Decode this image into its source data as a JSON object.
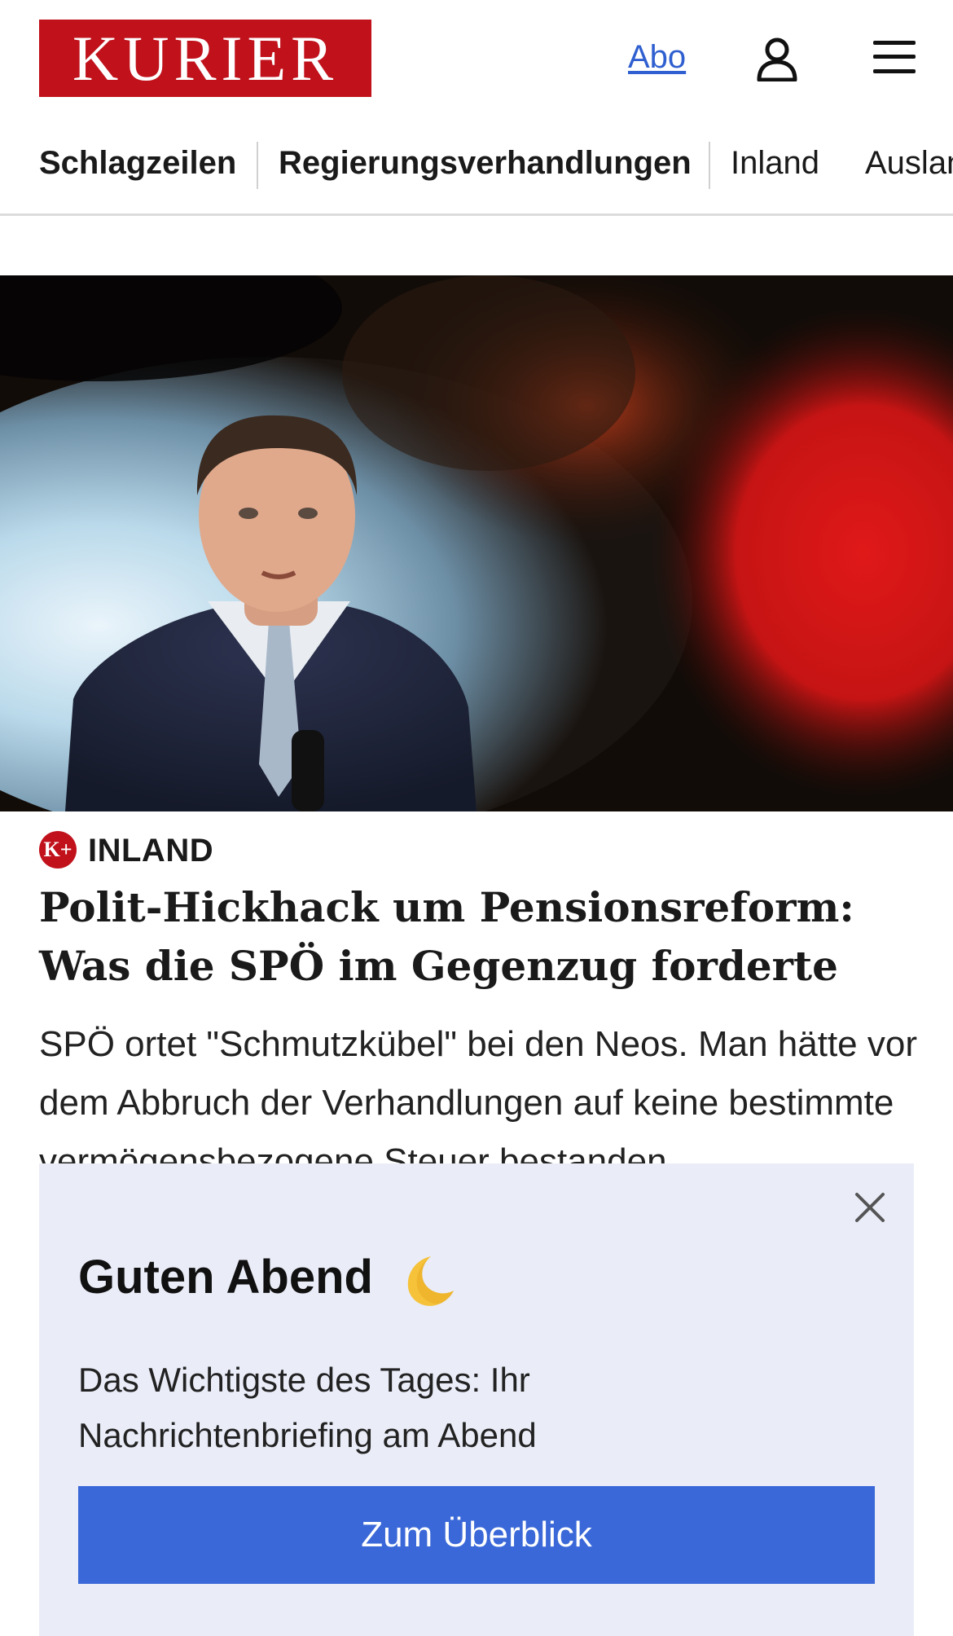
{
  "header": {
    "logo_text": "KURIER",
    "abo_label": "Abo",
    "brand_color": "#c1121c",
    "link_color": "#2f5fd0",
    "icons": [
      "user-icon",
      "menu-icon"
    ]
  },
  "nav": {
    "items": [
      {
        "label": "Schlagzeilen",
        "bold": true
      },
      {
        "label": "Regierungsverhandlungen",
        "bold": true
      },
      {
        "label": "Inland",
        "bold": false
      },
      {
        "label": "Ausland",
        "bold": false
      }
    ]
  },
  "article": {
    "badge": "K+",
    "category": "INLAND",
    "headline": "Polit-Hickhack um Pensionsreform: Was die SPÖ im Gegenzug forderte",
    "teaser": "SPÖ ortet \"Schmutzkübel\" bei den Neos. Man hätte vor dem Abbruch der Verhandlungen auf keine bestimmte vermögensbezogene Steuer bestanden."
  },
  "briefing": {
    "title": "Guten Abend",
    "text": "Das Wichtigste des Tages: Ihr Nachrichtenbriefing am Abend",
    "button_label": "Zum Überblick",
    "background": "#eaedf8",
    "button_color": "#3a68d8",
    "icons": [
      "close-icon",
      "moon-icon"
    ]
  }
}
